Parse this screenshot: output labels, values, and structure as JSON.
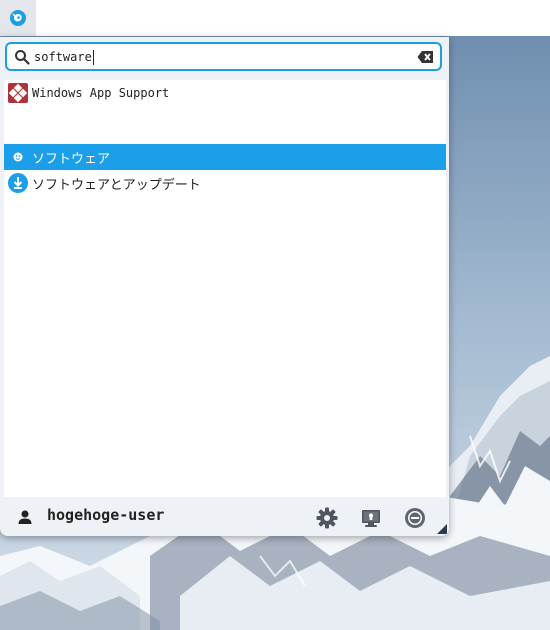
{
  "panel": {
    "menu_button_icon": "app-menu-icon"
  },
  "search": {
    "value": "software",
    "search_icon": "search-icon",
    "clear_icon": "clear-text-icon"
  },
  "results": [
    {
      "label": "Windows App Support",
      "icon": "windows-app-support-icon",
      "selected": false
    },
    {
      "label": "ソフトウェア",
      "icon": "software-icon",
      "selected": true
    },
    {
      "label": "ソフトウェアとアップデート",
      "icon": "software-updates-icon",
      "selected": false
    }
  ],
  "user": {
    "name": "hogehoge-user",
    "icon": "user-icon"
  },
  "actions": {
    "settings_icon": "gear-icon",
    "lock_icon": "lock-screen-icon",
    "logout_icon": "logout-icon"
  },
  "colors": {
    "accent": "#1b9fe8",
    "selected_text": "#ffffff",
    "menu_background": "#eef1f5"
  }
}
